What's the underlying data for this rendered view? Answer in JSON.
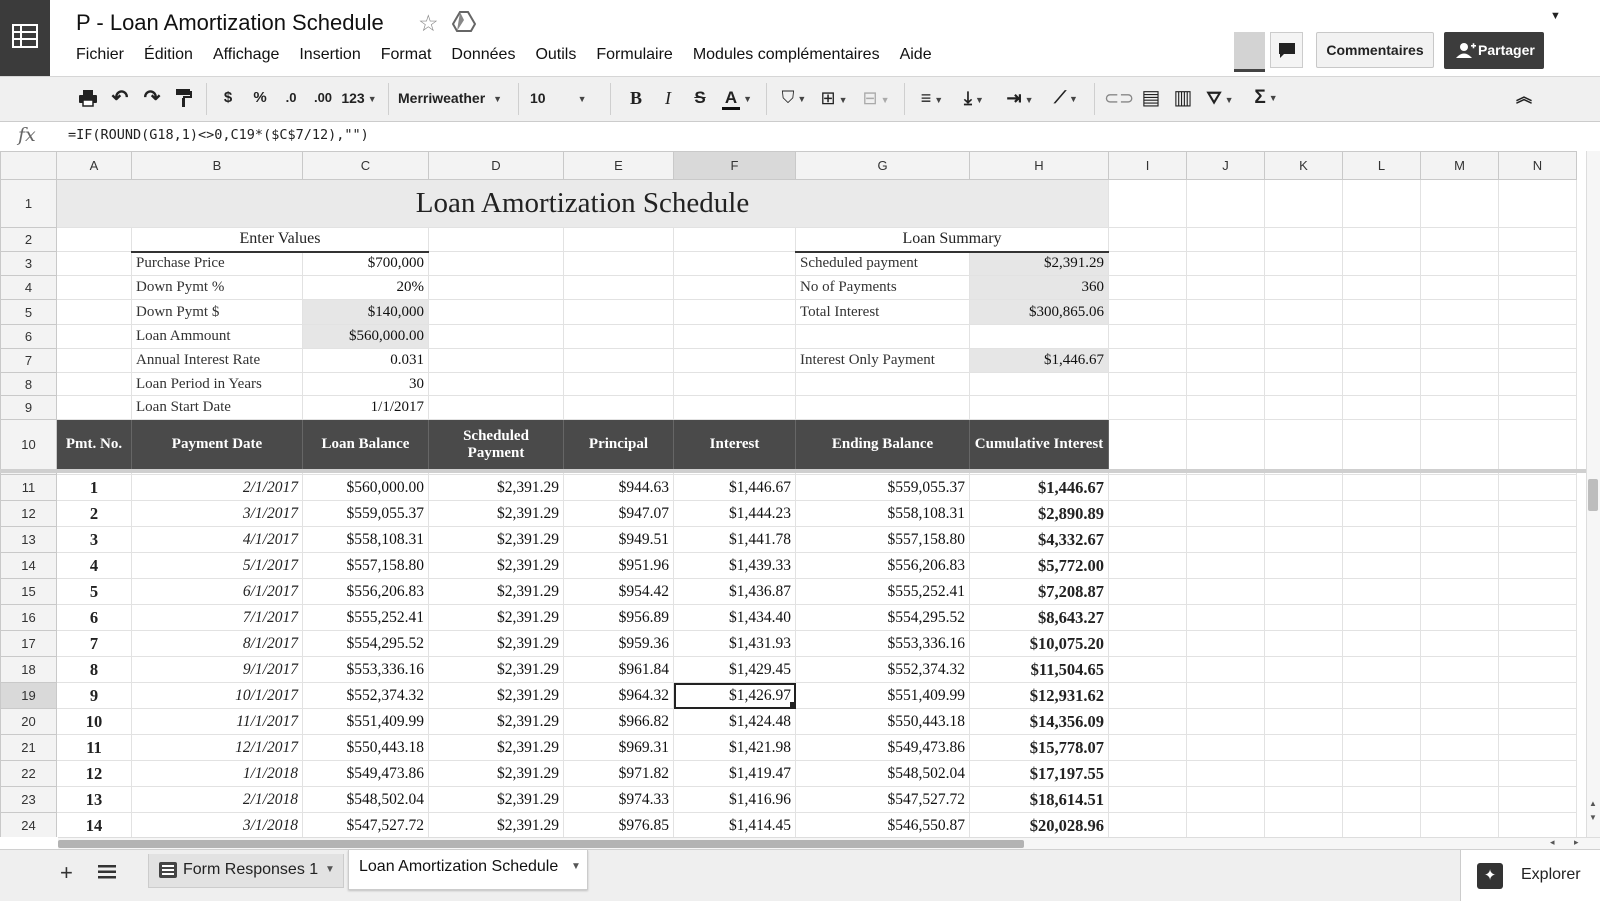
{
  "document": {
    "title": "P - Loan Amortization Schedule"
  },
  "menu": [
    "Fichier",
    "Édition",
    "Affichage",
    "Insertion",
    "Format",
    "Données",
    "Outils",
    "Formulaire",
    "Modules complémentaires",
    "Aide"
  ],
  "buttons": {
    "comments": "Commentaires",
    "share": "Partager"
  },
  "toolbar": {
    "currency": "$",
    "percent": "%",
    "decrease_decimal": ".0",
    "increase_decimal": ".00",
    "more_formats": "123",
    "font": "Merriweather",
    "font_size": "10",
    "bold": "B",
    "italic": "I",
    "strike": "S",
    "text_color": "A",
    "sum": "Σ"
  },
  "formula_bar": {
    "fx": "fx",
    "formula": "=IF(ROUND(G18,1)<>0,C19*($C$7/12),\"\")"
  },
  "columns": [
    "A",
    "B",
    "C",
    "D",
    "E",
    "F",
    "G",
    "H",
    "I",
    "J",
    "K",
    "L",
    "M",
    "N"
  ],
  "selected_column": "F",
  "selected_row": "19",
  "sheet": {
    "title": "Loan Amortization Schedule",
    "enter_values_header": "Enter Values",
    "loan_summary_header": "Loan Summary",
    "inputs": [
      {
        "label": "Purchase Price",
        "value": "$700,000"
      },
      {
        "label": "Down Pymt %",
        "value": "20%"
      },
      {
        "label": "Down Pymt $",
        "value": "$140,000"
      },
      {
        "label": "Loan Ammount",
        "value": "$560,000.00"
      },
      {
        "label": "Annual Interest Rate",
        "value": "0.031"
      },
      {
        "label": "Loan Period in Years",
        "value": "30"
      },
      {
        "label": "Loan Start Date",
        "value": "1/1/2017"
      }
    ],
    "summary": [
      {
        "label": "Scheduled payment",
        "value": "$2,391.29"
      },
      {
        "label": "No of Payments",
        "value": "360"
      },
      {
        "label": "Total Interest",
        "value": "$300,865.06"
      },
      {
        "label": "",
        "value": ""
      },
      {
        "label": "Interest Only Payment",
        "value": "$1,446.67"
      }
    ],
    "table_headers": [
      "Pmt. No.",
      "Payment Date",
      "Loan Balance",
      "Scheduled Payment",
      "Principal",
      "Interest",
      "Ending Balance",
      "Cumulative Interest"
    ],
    "rows": [
      {
        "row": "11",
        "cells": [
          "1",
          "2/1/2017",
          "$560,000.00",
          "$2,391.29",
          "$944.63",
          "$1,446.67",
          "$559,055.37",
          "$1,446.67"
        ]
      },
      {
        "row": "12",
        "cells": [
          "2",
          "3/1/2017",
          "$559,055.37",
          "$2,391.29",
          "$947.07",
          "$1,444.23",
          "$558,108.31",
          "$2,890.89"
        ]
      },
      {
        "row": "13",
        "cells": [
          "3",
          "4/1/2017",
          "$558,108.31",
          "$2,391.29",
          "$949.51",
          "$1,441.78",
          "$557,158.80",
          "$4,332.67"
        ]
      },
      {
        "row": "14",
        "cells": [
          "4",
          "5/1/2017",
          "$557,158.80",
          "$2,391.29",
          "$951.96",
          "$1,439.33",
          "$556,206.83",
          "$5,772.00"
        ]
      },
      {
        "row": "15",
        "cells": [
          "5",
          "6/1/2017",
          "$556,206.83",
          "$2,391.29",
          "$954.42",
          "$1,436.87",
          "$555,252.41",
          "$7,208.87"
        ]
      },
      {
        "row": "16",
        "cells": [
          "6",
          "7/1/2017",
          "$555,252.41",
          "$2,391.29",
          "$956.89",
          "$1,434.40",
          "$554,295.52",
          "$8,643.27"
        ]
      },
      {
        "row": "17",
        "cells": [
          "7",
          "8/1/2017",
          "$554,295.52",
          "$2,391.29",
          "$959.36",
          "$1,431.93",
          "$553,336.16",
          "$10,075.20"
        ]
      },
      {
        "row": "18",
        "cells": [
          "8",
          "9/1/2017",
          "$553,336.16",
          "$2,391.29",
          "$961.84",
          "$1,429.45",
          "$552,374.32",
          "$11,504.65"
        ]
      },
      {
        "row": "19",
        "cells": [
          "9",
          "10/1/2017",
          "$552,374.32",
          "$2,391.29",
          "$964.32",
          "$1,426.97",
          "$551,409.99",
          "$12,931.62"
        ]
      },
      {
        "row": "20",
        "cells": [
          "10",
          "11/1/2017",
          "$551,409.99",
          "$2,391.29",
          "$966.82",
          "$1,424.48",
          "$550,443.18",
          "$14,356.09"
        ]
      },
      {
        "row": "21",
        "cells": [
          "11",
          "12/1/2017",
          "$550,443.18",
          "$2,391.29",
          "$969.31",
          "$1,421.98",
          "$549,473.86",
          "$15,778.07"
        ]
      },
      {
        "row": "22",
        "cells": [
          "12",
          "1/1/2018",
          "$549,473.86",
          "$2,391.29",
          "$971.82",
          "$1,419.47",
          "$548,502.04",
          "$17,197.55"
        ]
      },
      {
        "row": "23",
        "cells": [
          "13",
          "2/1/2018",
          "$548,502.04",
          "$2,391.29",
          "$974.33",
          "$1,416.96",
          "$547,527.72",
          "$18,614.51"
        ]
      },
      {
        "row": "24",
        "cells": [
          "14",
          "3/1/2018",
          "$547,527.72",
          "$2,391.29",
          "$976.85",
          "$1,414.45",
          "$546,550.87",
          "$20,028.96"
        ]
      }
    ]
  },
  "sheet_tabs": [
    {
      "label": "Form Responses 1",
      "active": false
    },
    {
      "label": "Loan Amortization Schedule",
      "active": true
    }
  ],
  "explorer": {
    "label": "Explorer"
  },
  "colors": {
    "header_dark": "#4a4a4a",
    "title_band": "#eaeaea",
    "input_shade": "#e6e6e6",
    "app_icon": "#3b3b3b"
  }
}
